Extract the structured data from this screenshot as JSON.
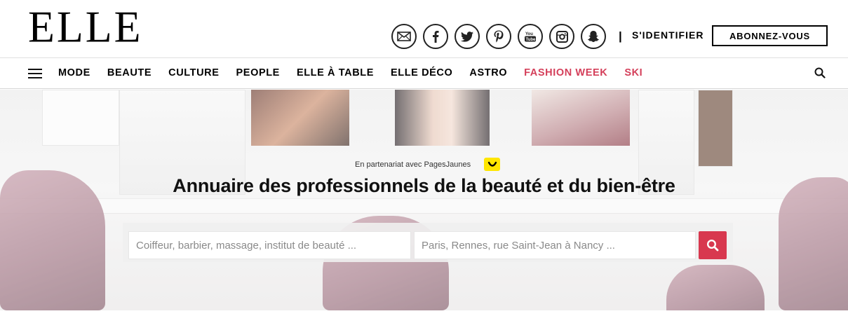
{
  "header": {
    "logo": "ELLE",
    "socials": [
      {
        "name": "newsletter-icon"
      },
      {
        "name": "facebook-icon"
      },
      {
        "name": "twitter-icon"
      },
      {
        "name": "pinterest-icon"
      },
      {
        "name": "youtube-icon"
      },
      {
        "name": "instagram-icon"
      },
      {
        "name": "snapchat-icon"
      }
    ],
    "divider": "|",
    "login_label": "S'IDENTIFIER",
    "subscribe_label": "ABONNEZ-VOUS"
  },
  "nav": {
    "items": [
      {
        "label": "MODE"
      },
      {
        "label": "BEAUTE"
      },
      {
        "label": "CULTURE"
      },
      {
        "label": "PEOPLE"
      },
      {
        "label": "ELLE À TABLE"
      },
      {
        "label": "ELLE DÉCO"
      },
      {
        "label": "ASTRO"
      },
      {
        "label": "FASHION WEEK"
      },
      {
        "label": "SKI"
      }
    ],
    "accent_color": "#d43f5a"
  },
  "hero": {
    "partner_text": "En partenariat avec PagesJaunes",
    "title": "Annuaire des professionnels de la beauté et du bien-être",
    "what_placeholder": "Coiffeur, barbier, massage, institut de beauté ...",
    "where_placeholder": "Paris, Rennes, rue Saint-Jean à Nancy ...",
    "search_button_color": "#d8384f",
    "partner_logo_color": "#ffe600"
  }
}
